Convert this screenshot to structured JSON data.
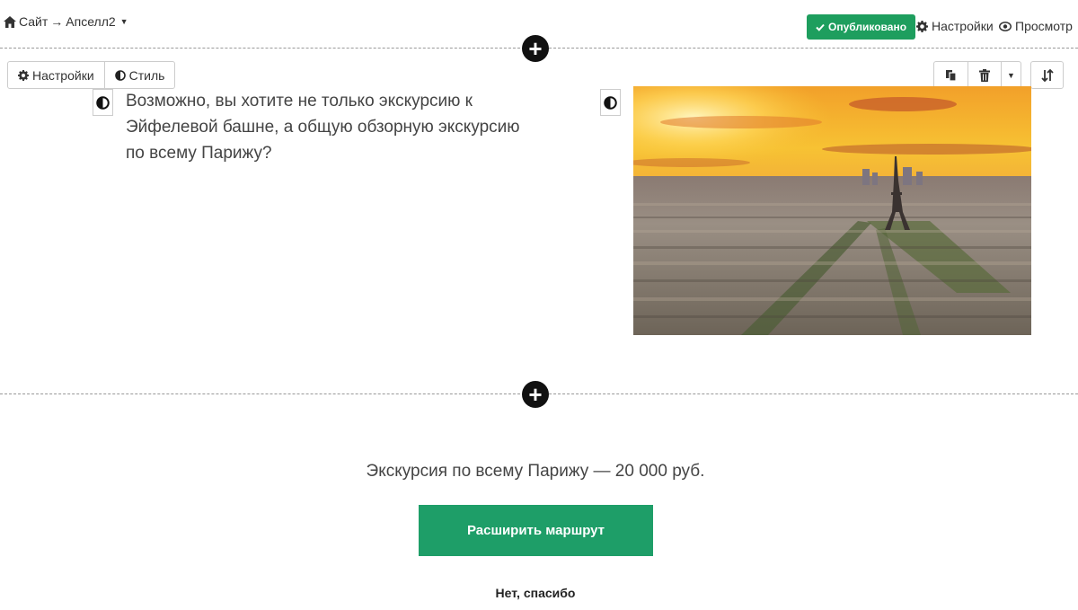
{
  "topbar": {
    "breadcrumb_site": "Сайт",
    "breadcrumb_arrow": "→",
    "breadcrumb_page": "Апселл2",
    "published_label": "Опубликовано",
    "settings_label": "Настройки",
    "preview_label": "Просмотр"
  },
  "block_toolbar": {
    "settings_label": "Настройки",
    "style_label": "Стиль"
  },
  "content": {
    "intro_text": "Возможно, вы хотите не только экскурсию к Эйфелевой башне, а общую обзорную экскурсию по всему Парижу?",
    "price_text": "Экскурсия по всему Парижу — 20 000 руб.",
    "cta_label": "Расширить маршрут",
    "decline_label": "Нет, спасибо"
  },
  "icons": {
    "home": "home-icon",
    "check": "check-icon",
    "gear": "gear-icon",
    "eye": "eye-icon",
    "contrast": "contrast-icon",
    "copy": "copy-icon",
    "trash": "trash-icon",
    "sort": "sort-icon",
    "plus": "plus-icon"
  },
  "colors": {
    "accent": "#1e9e68",
    "published": "#1e9e5e"
  }
}
